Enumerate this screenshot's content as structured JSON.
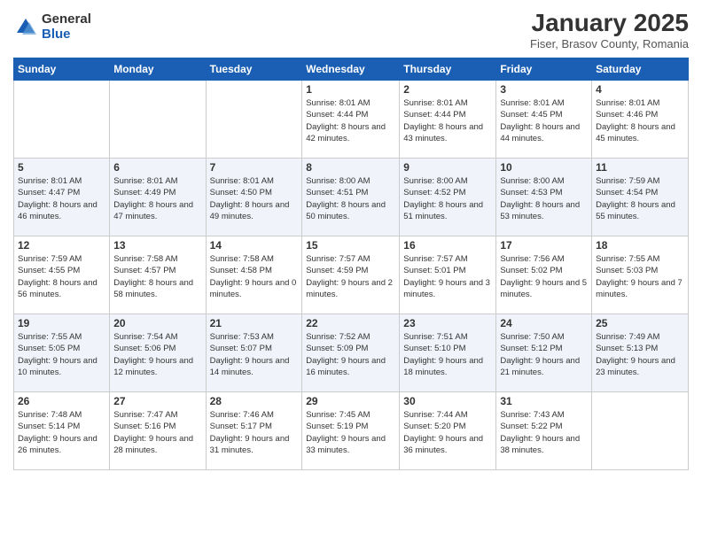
{
  "header": {
    "logo_general": "General",
    "logo_blue": "Blue",
    "month": "January 2025",
    "location": "Fiser, Brasov County, Romania"
  },
  "days_of_week": [
    "Sunday",
    "Monday",
    "Tuesday",
    "Wednesday",
    "Thursday",
    "Friday",
    "Saturday"
  ],
  "weeks": [
    [
      {
        "day": "",
        "info": ""
      },
      {
        "day": "",
        "info": ""
      },
      {
        "day": "",
        "info": ""
      },
      {
        "day": "1",
        "info": "Sunrise: 8:01 AM\nSunset: 4:44 PM\nDaylight: 8 hours and 42 minutes."
      },
      {
        "day": "2",
        "info": "Sunrise: 8:01 AM\nSunset: 4:44 PM\nDaylight: 8 hours and 43 minutes."
      },
      {
        "day": "3",
        "info": "Sunrise: 8:01 AM\nSunset: 4:45 PM\nDaylight: 8 hours and 44 minutes."
      },
      {
        "day": "4",
        "info": "Sunrise: 8:01 AM\nSunset: 4:46 PM\nDaylight: 8 hours and 45 minutes."
      }
    ],
    [
      {
        "day": "5",
        "info": "Sunrise: 8:01 AM\nSunset: 4:47 PM\nDaylight: 8 hours and 46 minutes."
      },
      {
        "day": "6",
        "info": "Sunrise: 8:01 AM\nSunset: 4:49 PM\nDaylight: 8 hours and 47 minutes."
      },
      {
        "day": "7",
        "info": "Sunrise: 8:01 AM\nSunset: 4:50 PM\nDaylight: 8 hours and 49 minutes."
      },
      {
        "day": "8",
        "info": "Sunrise: 8:00 AM\nSunset: 4:51 PM\nDaylight: 8 hours and 50 minutes."
      },
      {
        "day": "9",
        "info": "Sunrise: 8:00 AM\nSunset: 4:52 PM\nDaylight: 8 hours and 51 minutes."
      },
      {
        "day": "10",
        "info": "Sunrise: 8:00 AM\nSunset: 4:53 PM\nDaylight: 8 hours and 53 minutes."
      },
      {
        "day": "11",
        "info": "Sunrise: 7:59 AM\nSunset: 4:54 PM\nDaylight: 8 hours and 55 minutes."
      }
    ],
    [
      {
        "day": "12",
        "info": "Sunrise: 7:59 AM\nSunset: 4:55 PM\nDaylight: 8 hours and 56 minutes."
      },
      {
        "day": "13",
        "info": "Sunrise: 7:58 AM\nSunset: 4:57 PM\nDaylight: 8 hours and 58 minutes."
      },
      {
        "day": "14",
        "info": "Sunrise: 7:58 AM\nSunset: 4:58 PM\nDaylight: 9 hours and 0 minutes."
      },
      {
        "day": "15",
        "info": "Sunrise: 7:57 AM\nSunset: 4:59 PM\nDaylight: 9 hours and 2 minutes."
      },
      {
        "day": "16",
        "info": "Sunrise: 7:57 AM\nSunset: 5:01 PM\nDaylight: 9 hours and 3 minutes."
      },
      {
        "day": "17",
        "info": "Sunrise: 7:56 AM\nSunset: 5:02 PM\nDaylight: 9 hours and 5 minutes."
      },
      {
        "day": "18",
        "info": "Sunrise: 7:55 AM\nSunset: 5:03 PM\nDaylight: 9 hours and 7 minutes."
      }
    ],
    [
      {
        "day": "19",
        "info": "Sunrise: 7:55 AM\nSunset: 5:05 PM\nDaylight: 9 hours and 10 minutes."
      },
      {
        "day": "20",
        "info": "Sunrise: 7:54 AM\nSunset: 5:06 PM\nDaylight: 9 hours and 12 minutes."
      },
      {
        "day": "21",
        "info": "Sunrise: 7:53 AM\nSunset: 5:07 PM\nDaylight: 9 hours and 14 minutes."
      },
      {
        "day": "22",
        "info": "Sunrise: 7:52 AM\nSunset: 5:09 PM\nDaylight: 9 hours and 16 minutes."
      },
      {
        "day": "23",
        "info": "Sunrise: 7:51 AM\nSunset: 5:10 PM\nDaylight: 9 hours and 18 minutes."
      },
      {
        "day": "24",
        "info": "Sunrise: 7:50 AM\nSunset: 5:12 PM\nDaylight: 9 hours and 21 minutes."
      },
      {
        "day": "25",
        "info": "Sunrise: 7:49 AM\nSunset: 5:13 PM\nDaylight: 9 hours and 23 minutes."
      }
    ],
    [
      {
        "day": "26",
        "info": "Sunrise: 7:48 AM\nSunset: 5:14 PM\nDaylight: 9 hours and 26 minutes."
      },
      {
        "day": "27",
        "info": "Sunrise: 7:47 AM\nSunset: 5:16 PM\nDaylight: 9 hours and 28 minutes."
      },
      {
        "day": "28",
        "info": "Sunrise: 7:46 AM\nSunset: 5:17 PM\nDaylight: 9 hours and 31 minutes."
      },
      {
        "day": "29",
        "info": "Sunrise: 7:45 AM\nSunset: 5:19 PM\nDaylight: 9 hours and 33 minutes."
      },
      {
        "day": "30",
        "info": "Sunrise: 7:44 AM\nSunset: 5:20 PM\nDaylight: 9 hours and 36 minutes."
      },
      {
        "day": "31",
        "info": "Sunrise: 7:43 AM\nSunset: 5:22 PM\nDaylight: 9 hours and 38 minutes."
      },
      {
        "day": "",
        "info": ""
      }
    ]
  ]
}
